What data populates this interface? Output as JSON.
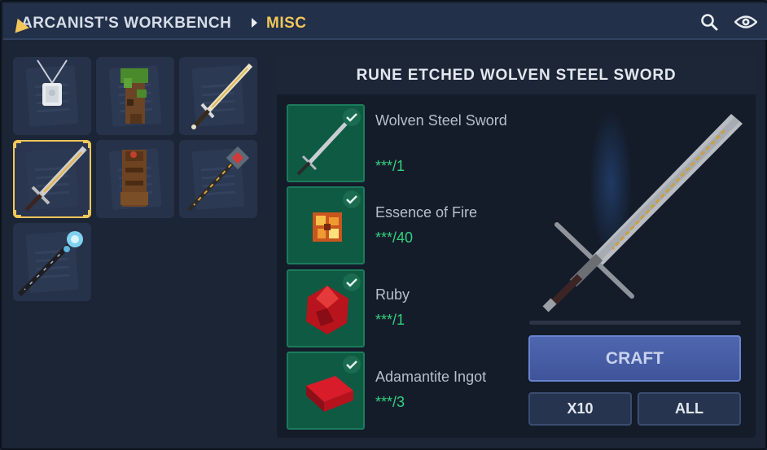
{
  "header": {
    "breadcrumb_root": "ARCANIST'S WORKBENCH",
    "breadcrumb_current": "MISC",
    "icons": [
      "search-icon",
      "eye-icon"
    ]
  },
  "grid": {
    "items": [
      {
        "name": "necklace",
        "selected": false
      },
      {
        "name": "mossy-wood-totem",
        "selected": false
      },
      {
        "name": "gold-sword",
        "selected": false
      },
      {
        "name": "rune-sword",
        "selected": true
      },
      {
        "name": "wood-totem",
        "selected": false
      },
      {
        "name": "ruby-staff",
        "selected": false
      },
      {
        "name": "ice-staff",
        "selected": false
      }
    ]
  },
  "recipe": {
    "title": "RUNE ETCHED WOLVEN STEEL SWORD",
    "ingredients": [
      {
        "name": "Wolven Steel Sword",
        "qty": "***/1",
        "icon": "steel-sword-icon"
      },
      {
        "name": "Essence of Fire",
        "qty": "***/40",
        "icon": "fire-essence-icon"
      },
      {
        "name": "Ruby",
        "qty": "***/1",
        "icon": "ruby-icon"
      },
      {
        "name": "Adamantite Ingot",
        "qty": "***/3",
        "icon": "ingot-icon"
      }
    ],
    "craft_label": "CRAFT",
    "x10_label": "X10",
    "all_label": "ALL"
  },
  "colors": {
    "accent_gold": "#f2c65a",
    "ingredient_bg": "#0f5a42",
    "qty_green": "#35d07f",
    "craft_blue": "#4f67b0"
  }
}
